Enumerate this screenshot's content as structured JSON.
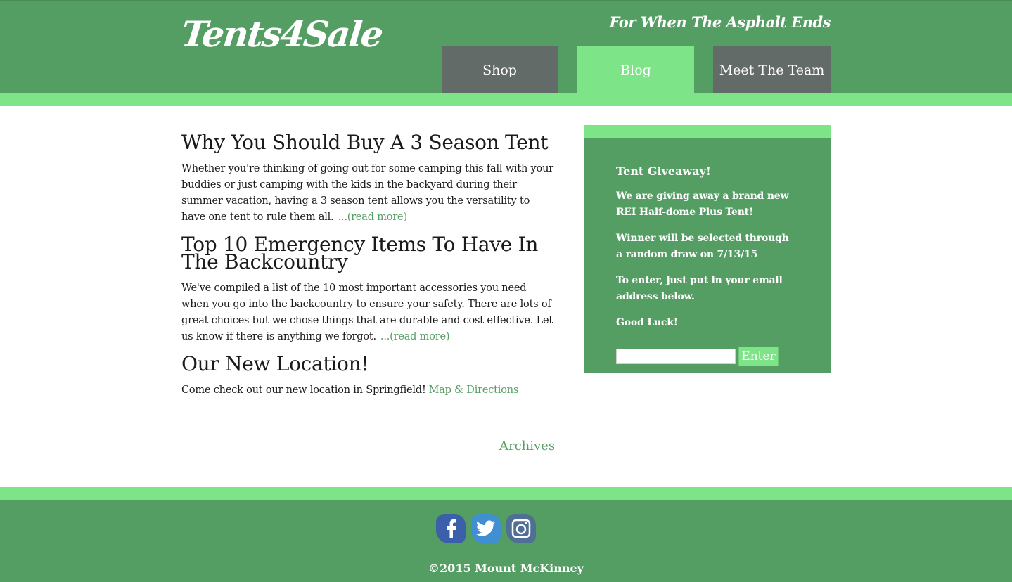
{
  "header": {
    "logo": "Tents4Sale",
    "tagline": "For When The Asphalt Ends",
    "nav": [
      {
        "label": "Shop"
      },
      {
        "label": "Blog"
      },
      {
        "label": "Meet The Team"
      }
    ],
    "active_nav": "Blog"
  },
  "posts": [
    {
      "title": "Why You Should Buy A 3 Season Tent",
      "body": "Whether you're thinking of going out for some camping this fall with your buddies or just camping with the kids in the backyard during their summer vacation, having a 3 season tent allows you the versatility to have one tent to rule them all.",
      "link": "...(read more)"
    },
    {
      "title": "Top 10 Emergency Items To Have In The Backcountry",
      "body": "We've compiled a list of the 10 most important accessories you need when you go into the backcountry to ensure your safety. There are lots of great choices but we chose things that are durable and cost effective. Let us know if there is anything we forgot.",
      "link": "...(read more)"
    },
    {
      "title": "Our New Location!",
      "body": "Come check out our new location in Springfield!",
      "link": "Map & Directions"
    }
  ],
  "archives_label": "Archives",
  "sidebar": {
    "title": "Tent Giveaway!",
    "paragraphs": [
      "We are giving away a brand new REI Half-dome Plus Tent!",
      "Winner will be selected through a random draw on 7/13/15",
      "To enter, just put in your email address below.",
      "Good Luck!"
    ],
    "email_value": "",
    "enter_label": "Enter"
  },
  "footer": {
    "social_icons": [
      "facebook-icon",
      "twitter-icon",
      "instagram-icon"
    ],
    "copyright": "©2015 Mount McKinney"
  },
  "colors": {
    "primary_green": "#559e63",
    "light_green": "#7ee488",
    "nav_gray": "#636b68"
  }
}
